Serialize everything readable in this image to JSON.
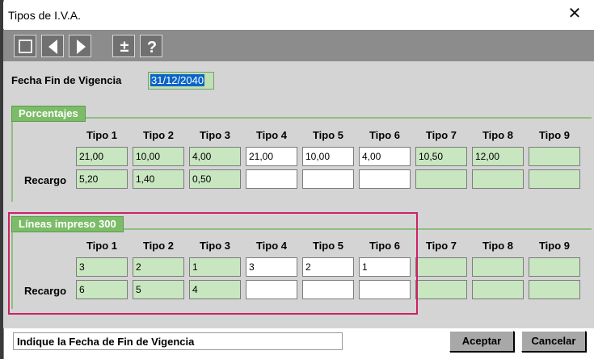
{
  "window": {
    "title": "Tipos de I.V.A.",
    "close_glyph": "✕"
  },
  "toolbar": {
    "icons": [
      "stop-icon",
      "arrow-left-icon",
      "arrow-right-icon",
      "plus-minus-icon",
      "help-icon"
    ]
  },
  "fecha": {
    "label": "Fecha Fin de Vigencia",
    "value": "31/12/2040"
  },
  "porcentajes": {
    "title": "Porcentajes",
    "headers": [
      "Tipo 1",
      "Tipo 2",
      "Tipo 3",
      "Tipo 4",
      "Tipo 5",
      "Tipo 6",
      "Tipo 7",
      "Tipo 8",
      "Tipo 9"
    ],
    "row1": [
      "21,00",
      "10,00",
      "4,00",
      "21,00",
      "10,00",
      "4,00",
      "10,50",
      "12,00",
      ""
    ],
    "recargo_label": "Recargo",
    "row2": [
      "5,20",
      "1,40",
      "0,50",
      "",
      "",
      "",
      "",
      "",
      ""
    ]
  },
  "lineas": {
    "title": "Líneas impreso 300",
    "headers": [
      "Tipo 1",
      "Tipo 2",
      "Tipo 3",
      "Tipo 4",
      "Tipo 5",
      "Tipo 6",
      "Tipo 7",
      "Tipo 8",
      "Tipo 9"
    ],
    "row1": [
      "3",
      "2",
      "1",
      "3",
      "2",
      "1",
      "",
      "",
      ""
    ],
    "recargo_label": "Recargo",
    "row2": [
      "6",
      "5",
      "4",
      "",
      "",
      "",
      "",
      "",
      ""
    ]
  },
  "status": {
    "text": "Indique la Fecha de Fin de Vigencia"
  },
  "buttons": {
    "accept": "Aceptar",
    "cancel": "Cancelar"
  },
  "colors": {
    "field_green": "#c8e6c0",
    "group_green": "#7cbc68",
    "highlight": "#cc2266",
    "selection": "#0a64c8"
  }
}
